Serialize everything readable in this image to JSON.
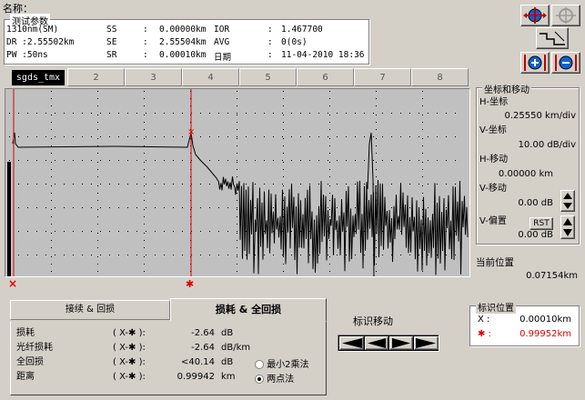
{
  "name_label": "名称：",
  "params": {
    "legend": "测试参数",
    "rows": [
      [
        "1310nm(SM)",
        "SS",
        ":",
        "0.00000km",
        "IOR",
        ":",
        "1.467700"
      ],
      [
        "DR  :2.55502km",
        "SE",
        ":",
        "2.55504km",
        "AVG",
        ":",
        "0(0s)"
      ],
      [
        "PW  :50ns",
        "SR",
        ":",
        "0.00010km",
        "日期",
        ":",
        "11-04-2010 18:36"
      ]
    ]
  },
  "tabs": [
    "sgds_tmx",
    "2",
    "3",
    "4",
    "5",
    "6",
    "7",
    "8"
  ],
  "coord": {
    "legend": "坐标和移动",
    "h_coord_label": "H-坐标",
    "h_coord_value": "0.25550 km/div",
    "v_coord_label": "V-坐标",
    "v_coord_value": "10.00 dB/div",
    "h_move_label": "H-移动",
    "h_move_value": "0.00000 km",
    "v_move_label": "V-移动",
    "v_move_value": "0.00 dB",
    "v_offset_label": "V-偏置",
    "rst_label": "RST",
    "v_offset_value": "0.00 dB"
  },
  "current_pos": {
    "label": "当前位置",
    "value": "0.07154km"
  },
  "bottom_tabs": {
    "tab1": "接续 & 回损",
    "tab2": "损耗 & 全回损"
  },
  "measure": {
    "rows": [
      {
        "label": "损耗",
        "marker": "( X-✱ ):",
        "value": "-2.64",
        "unit": "dB"
      },
      {
        "label": "光纤损耗",
        "marker": "( X-✱ ):",
        "value": "-2.64",
        "unit": "dB/km"
      },
      {
        "label": "全回损",
        "marker": "( X-✱ ):",
        "value": "<40.14",
        "unit": "dB"
      },
      {
        "label": "距离",
        "marker": "( X-✱ ):",
        "value": "0.99942",
        "unit": "km"
      }
    ],
    "radio1": "最小2乘法",
    "radio2": "两点法"
  },
  "marker_move_label": "标识移动",
  "marker_pos": {
    "legend": "标识位置",
    "x_label": "X  :",
    "x_value": "0.00010km",
    "star_label": "✱  :",
    "star_value": "0.99952km"
  },
  "marks": {
    "x": "×",
    "star": "✱"
  },
  "colors": {
    "trace": "#000000",
    "marker_red": "#e00000",
    "plot_bg": "#c0c0c0",
    "active_tab": "#000000"
  }
}
